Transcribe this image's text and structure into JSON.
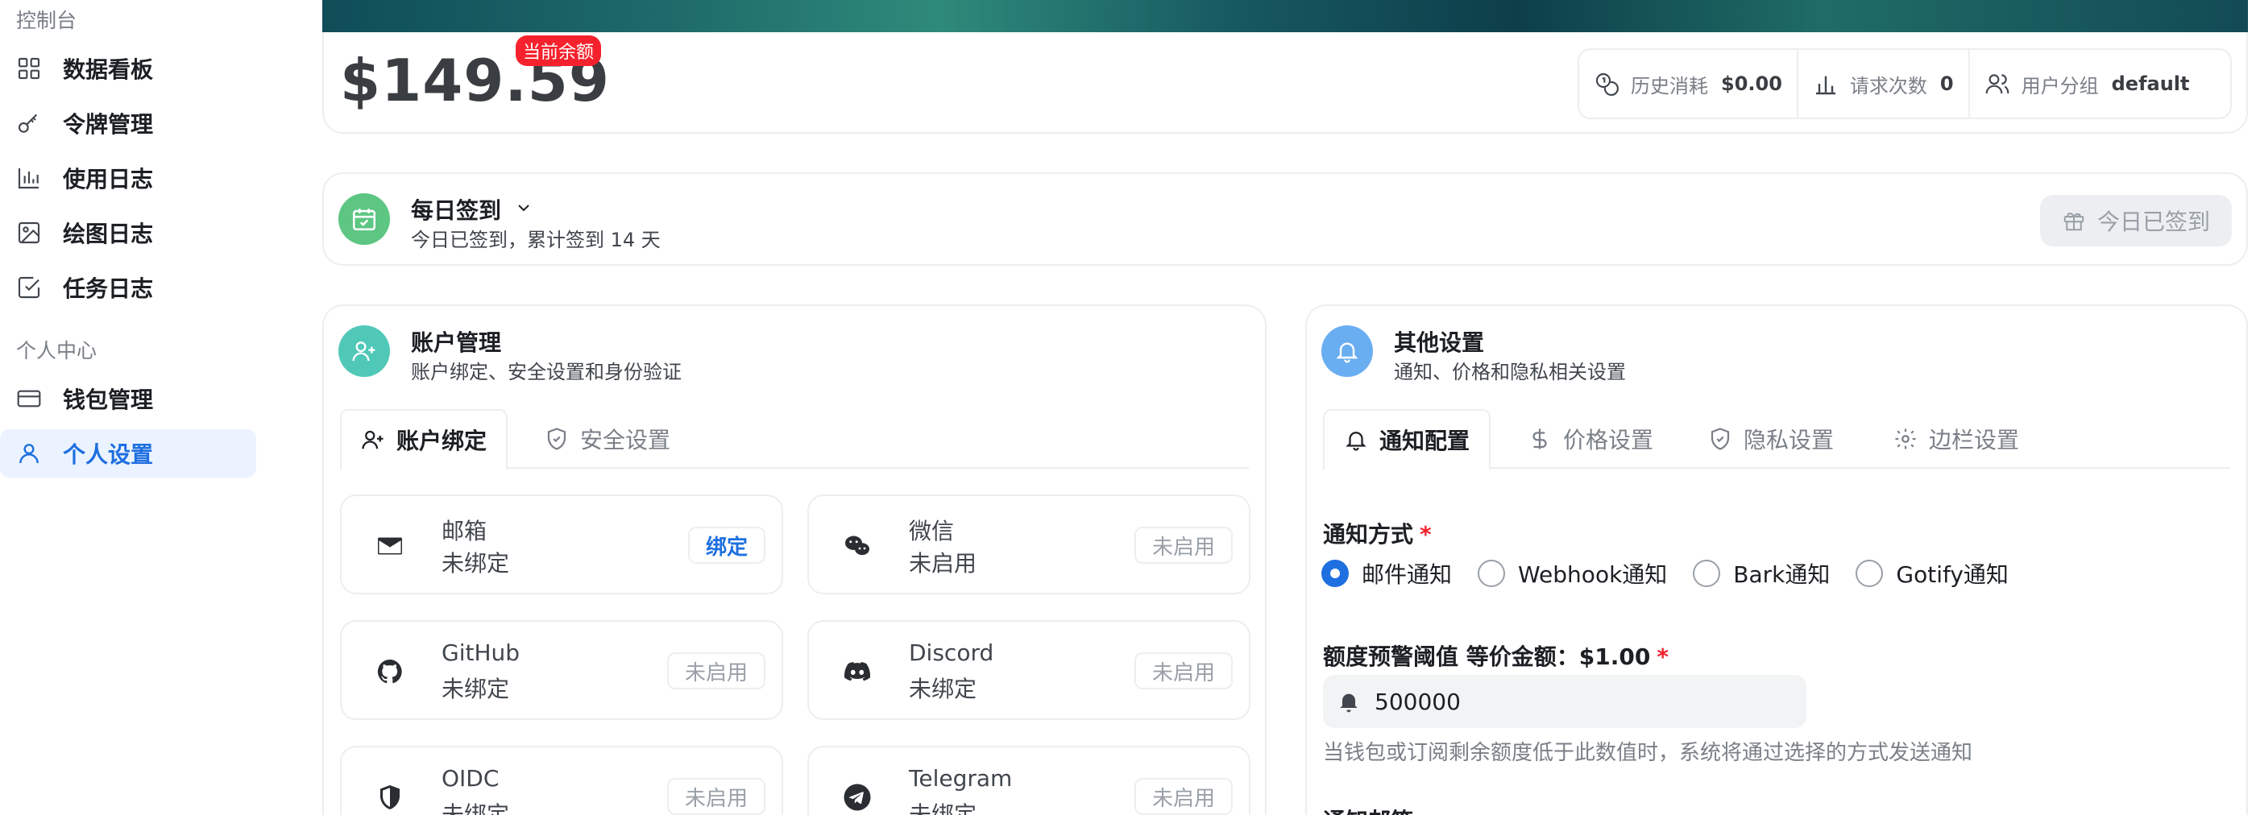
{
  "sidebar": {
    "section_console": "控制台",
    "section_personal": "个人中心",
    "items": [
      {
        "label": "数据看板",
        "icon": "dashboard-grid-icon"
      },
      {
        "label": "令牌管理",
        "icon": "key-icon"
      },
      {
        "label": "使用日志",
        "icon": "bar-chart-icon"
      },
      {
        "label": "绘图日志",
        "icon": "image-icon"
      },
      {
        "label": "任务日志",
        "icon": "checkbox-icon"
      },
      {
        "label": "钱包管理",
        "icon": "wallet-icon"
      },
      {
        "label": "个人设置",
        "icon": "user-icon",
        "active": true
      }
    ]
  },
  "balance": {
    "amount": "$149.59",
    "badge": "当前余额",
    "stats": [
      {
        "label": "历史消耗",
        "value": "$0.00",
        "icon": "coins-icon"
      },
      {
        "label": "请求次数",
        "value": "0",
        "icon": "bar-chart-icon"
      },
      {
        "label": "用户分组",
        "value": "default",
        "icon": "users-icon"
      }
    ]
  },
  "checkin": {
    "title": "每日签到",
    "subtitle": "今日已签到，累计签到 14 天",
    "button": "今日已签到"
  },
  "account": {
    "title": "账户管理",
    "subtitle": "账户绑定、安全设置和身份验证",
    "tabs": [
      "账户绑定",
      "安全设置"
    ],
    "bindings": [
      {
        "name": "邮箱",
        "status": "未绑定",
        "button": "绑定",
        "icon": "mail-icon"
      },
      {
        "name": "微信",
        "status": "未启用",
        "button": "未启用",
        "icon": "wechat-icon"
      },
      {
        "name": "GitHub",
        "status": "未绑定",
        "button": "未启用",
        "icon": "github-icon"
      },
      {
        "name": "Discord",
        "status": "未绑定",
        "button": "未启用",
        "icon": "discord-icon"
      },
      {
        "name": "OIDC",
        "status": "未绑定",
        "button": "未启用",
        "icon": "shield-icon"
      },
      {
        "name": "Telegram",
        "status": "未绑定",
        "button": "未启用",
        "icon": "telegram-icon"
      }
    ]
  },
  "other": {
    "title": "其他设置",
    "subtitle": "通知、价格和隐私相关设置",
    "tabs": [
      "通知配置",
      "价格设置",
      "隐私设置",
      "边栏设置"
    ],
    "notify_label": "通知方式",
    "required_mark": "*",
    "notify_options": [
      "邮件通知",
      "Webhook通知",
      "Bark通知",
      "Gotify通知"
    ],
    "threshold_label": "额度预警阈值 等价金额：$1.00",
    "threshold_value": "500000",
    "threshold_help": "当钱包或订阅剩余额度低于此数值时，系统将通过选择的方式发送通知",
    "next_label": "通知邮箱"
  },
  "colors": {
    "accent": "#1e6fe0",
    "checkin_green": "#5cc682",
    "account_teal": "#4fc8b8",
    "other_blue": "#6aaef2",
    "badge_red": "#f5222d"
  }
}
